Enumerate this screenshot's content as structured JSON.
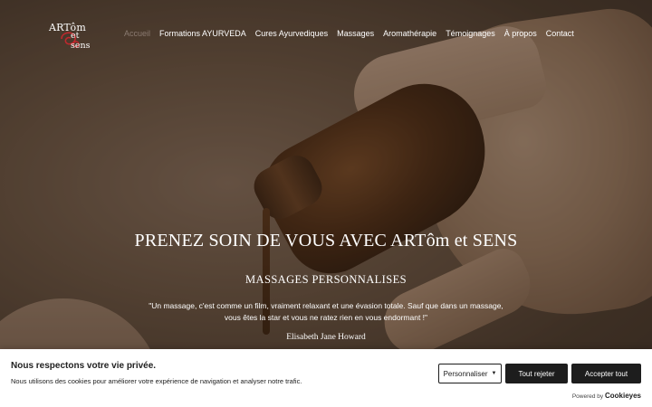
{
  "logo": {
    "line1": "ARTôm",
    "line2": "et sens",
    "accent_color": "#c0282d"
  },
  "nav": {
    "items": [
      {
        "label": "Accueil",
        "active": true
      },
      {
        "label": "Formations AYURVEDA"
      },
      {
        "label": "Cures Ayurvediques"
      },
      {
        "label": "Massages"
      },
      {
        "label": "Aromathérapie"
      },
      {
        "label": "Témoignages"
      },
      {
        "label": "À propos"
      },
      {
        "label": "Contact"
      }
    ]
  },
  "hero": {
    "title": "PRENEZ SOIN DE VOUS AVEC ARTôm et SENS",
    "subtitle": "MASSAGES PERSONNALISES",
    "quote_line1": "\"Un massage, c'est comme un film, vraiment relaxant et une évasion totale. Sauf que dans un massage,",
    "quote_line2": "vous êtes la star et vous ne ratez rien en vous endormant !\"",
    "author": "Elisabeth Jane Howard"
  },
  "cookie_banner": {
    "title": "Nous respectons votre vie privée.",
    "description": "Nous utilisons des cookies pour améliorer votre expérience de navigation et analyser notre trafic.",
    "customize_label": "Personnaliser",
    "reject_label": "Tout rejeter",
    "accept_label": "Accepter tout",
    "powered_prefix": "Powered by",
    "powered_brand": "Cookieyes"
  }
}
